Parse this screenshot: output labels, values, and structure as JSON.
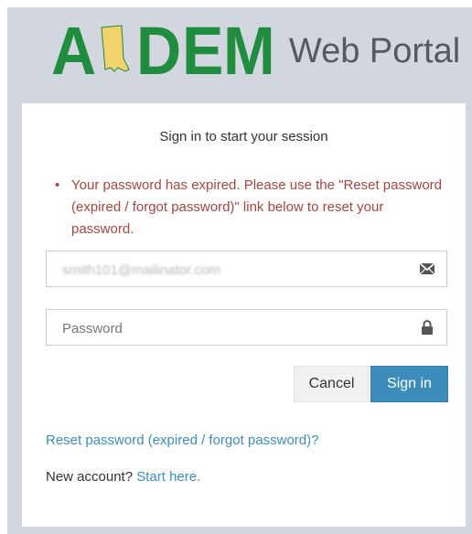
{
  "logo": {
    "letters": [
      "A",
      "D",
      "E",
      "M"
    ],
    "portal_text": "Web Portal",
    "brand_color": "#1f8c3e",
    "state_color": "#f2d26b"
  },
  "login": {
    "message": "Sign in to start your session",
    "error": "Your password has expired. Please use the \"Reset password (expired / forgot password)\" link below to reset your password.",
    "email_value": "smith101@mailinator.com",
    "password_placeholder": "Password",
    "cancel_label": "Cancel",
    "signin_label": "Sign in",
    "reset_link": "Reset password (expired / forgot password)?",
    "new_account_text": "New account?",
    "start_here_link": "Start here."
  },
  "icons": {
    "email": "envelope-icon",
    "password": "lock-icon"
  },
  "colors": {
    "background": "#d2d6de",
    "error": "#a94442",
    "primary": "#3c8dbc"
  }
}
